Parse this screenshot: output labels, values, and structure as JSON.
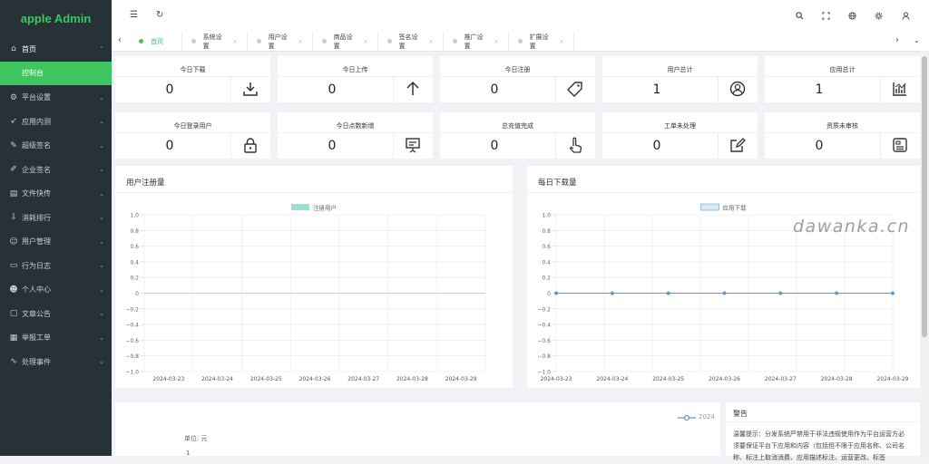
{
  "brand": "apple Admin",
  "sidebar": {
    "items": [
      {
        "label": "首页",
        "icon": "home-icon",
        "glyph": "⌂"
      },
      {
        "label": "平台设置",
        "icon": "gear-icon",
        "glyph": "⚙"
      },
      {
        "label": "应用内测",
        "icon": "rocket-icon",
        "glyph": "➶"
      },
      {
        "label": "超级签名",
        "icon": "signature-icon",
        "glyph": "✎"
      },
      {
        "label": "企业签名",
        "icon": "edit-icon",
        "glyph": "✐"
      },
      {
        "label": "文件快传",
        "icon": "folder-icon",
        "glyph": "▤"
      },
      {
        "label": "消耗排行",
        "icon": "rank-icon",
        "glyph": "⇩"
      },
      {
        "label": "用户管理",
        "icon": "user-icon",
        "glyph": "☺"
      },
      {
        "label": "行为日志",
        "icon": "log-icon",
        "glyph": "▭"
      },
      {
        "label": "个人中心",
        "icon": "person-icon",
        "glyph": "☻"
      },
      {
        "label": "文章公告",
        "icon": "monitor-icon",
        "glyph": "▢"
      },
      {
        "label": "举报工单",
        "icon": "report-icon",
        "glyph": "▦"
      },
      {
        "label": "处理事件",
        "icon": "pulse-icon",
        "glyph": "∿"
      }
    ],
    "active_sub": "控制台"
  },
  "topbar": {
    "menu_toggle": "☰",
    "refresh": "↻",
    "right_icons": [
      "search-icon",
      "fullscreen-icon",
      "globe-icon",
      "settings-icon",
      "user-icon"
    ]
  },
  "tabs": [
    {
      "label": "首页",
      "active": true
    },
    {
      "label": "系统设置"
    },
    {
      "label": "用户设置"
    },
    {
      "label": "商品设置"
    },
    {
      "label": "签名设置"
    },
    {
      "label": "推广设置"
    },
    {
      "label": "扩展设置"
    }
  ],
  "stats": [
    {
      "title": "今日下载",
      "value": "0",
      "icon": "download-icon"
    },
    {
      "title": "今日上传",
      "value": "0",
      "icon": "upload-arrow-icon"
    },
    {
      "title": "今日注册",
      "value": "0",
      "icon": "tag-icon"
    },
    {
      "title": "用户总计",
      "value": "1",
      "icon": "user-circle-icon"
    },
    {
      "title": "应用总计",
      "value": "1",
      "icon": "bar-chart-icon"
    },
    {
      "title": "今日登录用户",
      "value": "0",
      "icon": "lock-icon"
    },
    {
      "title": "今日点数新增",
      "value": "0",
      "icon": "presentation-icon"
    },
    {
      "title": "总充值完成",
      "value": "0",
      "icon": "hand-pointer-icon"
    },
    {
      "title": "工单未处理",
      "value": "0",
      "icon": "edit-square-icon"
    },
    {
      "title": "资质未审核",
      "value": "0",
      "icon": "id-card-icon"
    }
  ],
  "chart_data": [
    {
      "type": "line",
      "title": "用户注册量",
      "legend": "注册用户",
      "categories": [
        "2024-03-23",
        "2024-03-24",
        "2024-03-25",
        "2024-03-26",
        "2024-03-27",
        "2024-03-28",
        "2024-03-29"
      ],
      "series": [
        {
          "name": "注册用户",
          "values": [
            0,
            0,
            0,
            0,
            0,
            0,
            0
          ],
          "color": "#99e0d5",
          "show_line": false
        }
      ],
      "yticks": [
        "1.0",
        "0.8",
        "0.6",
        "0.4",
        "0.2",
        "0",
        "−0.2",
        "−0.4",
        "−0.6",
        "−0.8",
        "−1.0"
      ],
      "ylim": [
        -1,
        1
      ],
      "grid": true
    },
    {
      "type": "line",
      "title": "每日下载量",
      "legend": "应用下载",
      "categories": [
        "2024-03-23",
        "2024-03-24",
        "2024-03-25",
        "2024-03-26",
        "2024-03-27",
        "2024-03-28",
        "2024-03-29"
      ],
      "series": [
        {
          "name": "应用下载",
          "values": [
            0,
            0,
            0,
            0,
            0,
            0,
            0
          ],
          "color": "#5b9bd5",
          "show_line": true
        }
      ],
      "yticks": [
        "1.0",
        "0.8",
        "0.6",
        "0.4",
        "0.2",
        "0",
        "−0.2",
        "−0.4",
        "−0.6",
        "−0.8",
        "−1.0"
      ],
      "ylim": [
        -1,
        1
      ],
      "grid": true
    }
  ],
  "bottom": {
    "legend": "2024",
    "unit": "单位: 元",
    "tick": "1"
  },
  "warning": {
    "title": "警告",
    "text1": "温馨提示：分发系统严禁用于非法违规使用作为平台运营方必",
    "text2": "须要保证平台下应用和内容（包括但不限于应用名称、公司名",
    "text3": "称、标注上取消消费、应用描述标注、运营更改、标签"
  },
  "watermark": "dawanka.cn",
  "colors": {
    "accent": "#3ec55f",
    "sidebar_bg": "#263238"
  }
}
